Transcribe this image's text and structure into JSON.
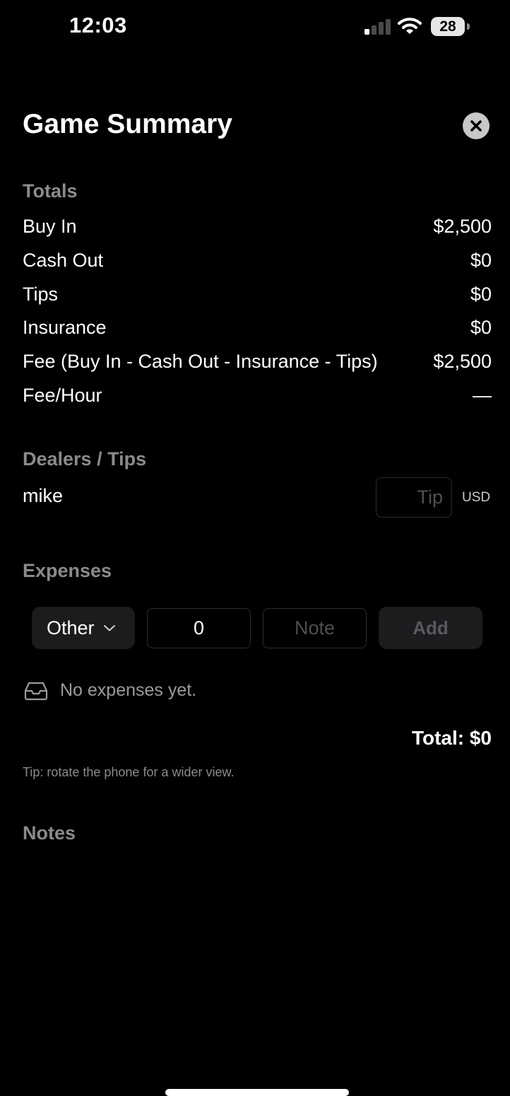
{
  "status_bar": {
    "time": "12:03",
    "battery": "28"
  },
  "title": "Game Summary",
  "totals": {
    "header": "Totals",
    "rows": [
      {
        "label": "Buy In",
        "value": "$2,500"
      },
      {
        "label": "Cash Out",
        "value": "$0"
      },
      {
        "label": "Tips",
        "value": "$0"
      },
      {
        "label": "Insurance",
        "value": "$0"
      },
      {
        "label": "Fee (Buy In - Cash Out - Insurance - Tips)",
        "value": "$2,500"
      },
      {
        "label": "Fee/Hour",
        "value": "—"
      }
    ]
  },
  "dealers": {
    "header": "Dealers / Tips",
    "name": "mike",
    "tip_placeholder": "Tip",
    "currency": "USD"
  },
  "expenses": {
    "header": "Expenses",
    "category": "Other",
    "amount": "0",
    "note_placeholder": "Note",
    "add_label": "Add",
    "empty_text": "No expenses yet.",
    "total": "Total: $0",
    "tip_hint": "Tip: rotate the phone for a wider view."
  },
  "notes": {
    "header": "Notes"
  },
  "icons": {
    "close": "close-icon",
    "chevron": "chevron-down-icon",
    "tray": "tray-icon"
  }
}
